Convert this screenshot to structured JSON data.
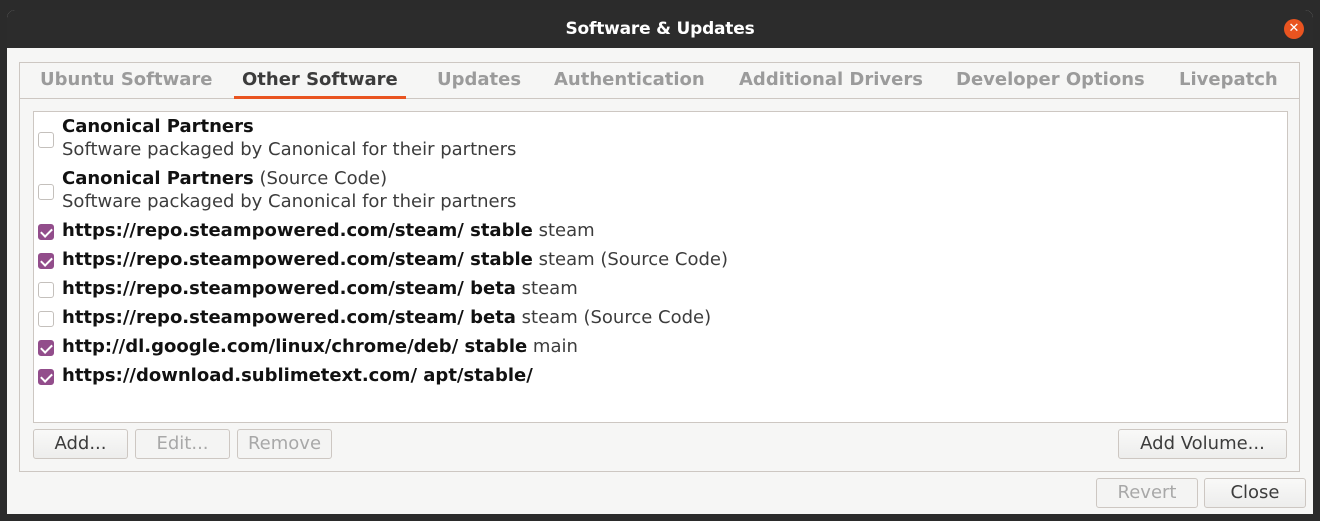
{
  "window": {
    "title": "Software & Updates"
  },
  "tabs": [
    {
      "label": "Ubuntu Software",
      "active": false
    },
    {
      "label": "Other Software",
      "active": true
    },
    {
      "label": "Updates",
      "active": false
    },
    {
      "label": "Authentication",
      "active": false
    },
    {
      "label": "Additional Drivers",
      "active": false
    },
    {
      "label": "Developer Options",
      "active": false
    },
    {
      "label": "Livepatch",
      "active": false
    }
  ],
  "sources": [
    {
      "checked": false,
      "bold": "Canonical Partners",
      "normal": "",
      "subtitle": "Software packaged by Canonical for their partners"
    },
    {
      "checked": false,
      "bold": "Canonical Partners",
      "normal": " (Source Code)",
      "subtitle": "Software packaged by Canonical for their partners"
    },
    {
      "checked": true,
      "bold": "https://repo.steampowered.com/steam/ stable",
      "normal": " steam"
    },
    {
      "checked": true,
      "bold": "https://repo.steampowered.com/steam/ stable",
      "normal": " steam (Source Code)"
    },
    {
      "checked": false,
      "bold": "https://repo.steampowered.com/steam/ beta",
      "normal": " steam"
    },
    {
      "checked": false,
      "bold": "https://repo.steampowered.com/steam/ beta",
      "normal": " steam (Source Code)"
    },
    {
      "checked": true,
      "bold": "http://dl.google.com/linux/chrome/deb/ stable",
      "normal": " main"
    },
    {
      "checked": true,
      "bold": "https://download.sublimetext.com/ apt/stable/",
      "normal": ""
    }
  ],
  "buttons": {
    "add": "Add...",
    "edit": "Edit...",
    "remove": "Remove",
    "add_volume": "Add Volume...",
    "revert": "Revert",
    "close": "Close"
  },
  "colors": {
    "accent": "#e95420",
    "checkbox_checked": "#924d8b",
    "titlebar": "#2c2c2c"
  },
  "icons": {
    "close": "close-icon"
  }
}
